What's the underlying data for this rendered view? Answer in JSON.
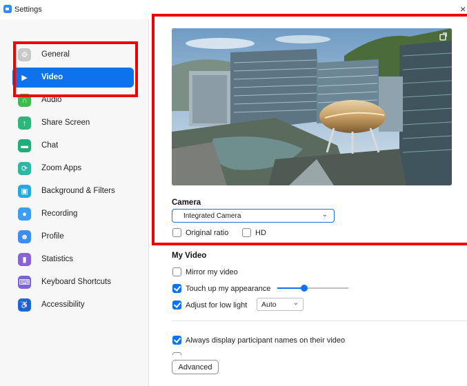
{
  "window": {
    "title": "Settings",
    "close_glyph": "×"
  },
  "sidebar": {
    "items": [
      {
        "label": "General",
        "icon": "gear-icon",
        "color": "#c9c9c9",
        "glyph": "⚙",
        "selected": false
      },
      {
        "label": "Video",
        "icon": "video-camera-icon",
        "color": "#0e72ed",
        "glyph": "▶",
        "selected": true
      },
      {
        "label": "Audio",
        "icon": "headphones-icon",
        "color": "#3fb950",
        "glyph": "∩",
        "selected": false
      },
      {
        "label": "Share Screen",
        "icon": "share-screen-icon",
        "color": "#2fb57a",
        "glyph": "↑",
        "selected": false
      },
      {
        "label": "Chat",
        "icon": "chat-icon",
        "color": "#1fae7a",
        "glyph": "▬",
        "selected": false
      },
      {
        "label": "Zoom Apps",
        "icon": "zoom-apps-icon",
        "color": "#2bb7a3",
        "glyph": "⟳",
        "selected": false
      },
      {
        "label": "Background & Filters",
        "icon": "background-filters-icon",
        "color": "#28a8d9",
        "glyph": "▣",
        "selected": false
      },
      {
        "label": "Recording",
        "icon": "recording-icon",
        "color": "#3b9ef0",
        "glyph": "●",
        "selected": false
      },
      {
        "label": "Profile",
        "icon": "profile-icon",
        "color": "#3b8ef0",
        "glyph": "☻",
        "selected": false
      },
      {
        "label": "Statistics",
        "icon": "statistics-icon",
        "color": "#8a63d2",
        "glyph": "▮",
        "selected": false
      },
      {
        "label": "Keyboard Shortcuts",
        "icon": "keyboard-icon",
        "color": "#7b62d6",
        "glyph": "⌨",
        "selected": false
      },
      {
        "label": "Accessibility",
        "icon": "accessibility-icon",
        "color": "#1f66d6",
        "glyph": "♿",
        "selected": false
      }
    ]
  },
  "camera": {
    "section_title": "Camera",
    "selected_camera": "Integrated Camera",
    "original_ratio": {
      "label": "Original ratio",
      "checked": false
    },
    "hd": {
      "label": "HD",
      "checked": false
    },
    "rotate_icon": "rotate-icon"
  },
  "my_video": {
    "section_title": "My Video",
    "mirror": {
      "label": "Mirror my video",
      "checked": false
    },
    "touch_up": {
      "label": "Touch up my appearance",
      "checked": true,
      "level": 0.38
    },
    "low_light": {
      "label": "Adjust for low light",
      "checked": true,
      "mode": "Auto"
    },
    "always_display_names": {
      "label": "Always display participant names on their video",
      "checked": true
    }
  },
  "buttons": {
    "advanced": "Advanced"
  },
  "colors": {
    "accent": "#0e72ed",
    "highlight": "#f20000"
  }
}
